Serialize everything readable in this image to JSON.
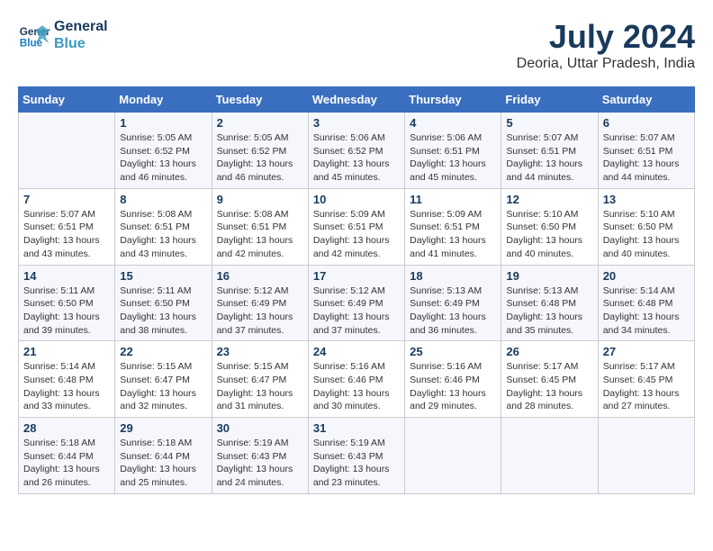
{
  "header": {
    "logo_line1": "General",
    "logo_line2": "Blue",
    "month_year": "July 2024",
    "location": "Deoria, Uttar Pradesh, India"
  },
  "days_of_week": [
    "Sunday",
    "Monday",
    "Tuesday",
    "Wednesday",
    "Thursday",
    "Friday",
    "Saturday"
  ],
  "weeks": [
    [
      {
        "day": "",
        "sunrise": "",
        "sunset": "",
        "daylight": ""
      },
      {
        "day": "1",
        "sunrise": "5:05 AM",
        "sunset": "6:52 PM",
        "daylight": "13 hours and 46 minutes."
      },
      {
        "day": "2",
        "sunrise": "5:05 AM",
        "sunset": "6:52 PM",
        "daylight": "13 hours and 46 minutes."
      },
      {
        "day": "3",
        "sunrise": "5:06 AM",
        "sunset": "6:52 PM",
        "daylight": "13 hours and 45 minutes."
      },
      {
        "day": "4",
        "sunrise": "5:06 AM",
        "sunset": "6:51 PM",
        "daylight": "13 hours and 45 minutes."
      },
      {
        "day": "5",
        "sunrise": "5:07 AM",
        "sunset": "6:51 PM",
        "daylight": "13 hours and 44 minutes."
      },
      {
        "day": "6",
        "sunrise": "5:07 AM",
        "sunset": "6:51 PM",
        "daylight": "13 hours and 44 minutes."
      }
    ],
    [
      {
        "day": "7",
        "sunrise": "5:07 AM",
        "sunset": "6:51 PM",
        "daylight": "13 hours and 43 minutes."
      },
      {
        "day": "8",
        "sunrise": "5:08 AM",
        "sunset": "6:51 PM",
        "daylight": "13 hours and 43 minutes."
      },
      {
        "day": "9",
        "sunrise": "5:08 AM",
        "sunset": "6:51 PM",
        "daylight": "13 hours and 42 minutes."
      },
      {
        "day": "10",
        "sunrise": "5:09 AM",
        "sunset": "6:51 PM",
        "daylight": "13 hours and 42 minutes."
      },
      {
        "day": "11",
        "sunrise": "5:09 AM",
        "sunset": "6:51 PM",
        "daylight": "13 hours and 41 minutes."
      },
      {
        "day": "12",
        "sunrise": "5:10 AM",
        "sunset": "6:50 PM",
        "daylight": "13 hours and 40 minutes."
      },
      {
        "day": "13",
        "sunrise": "5:10 AM",
        "sunset": "6:50 PM",
        "daylight": "13 hours and 40 minutes."
      }
    ],
    [
      {
        "day": "14",
        "sunrise": "5:11 AM",
        "sunset": "6:50 PM",
        "daylight": "13 hours and 39 minutes."
      },
      {
        "day": "15",
        "sunrise": "5:11 AM",
        "sunset": "6:50 PM",
        "daylight": "13 hours and 38 minutes."
      },
      {
        "day": "16",
        "sunrise": "5:12 AM",
        "sunset": "6:49 PM",
        "daylight": "13 hours and 37 minutes."
      },
      {
        "day": "17",
        "sunrise": "5:12 AM",
        "sunset": "6:49 PM",
        "daylight": "13 hours and 37 minutes."
      },
      {
        "day": "18",
        "sunrise": "5:13 AM",
        "sunset": "6:49 PM",
        "daylight": "13 hours and 36 minutes."
      },
      {
        "day": "19",
        "sunrise": "5:13 AM",
        "sunset": "6:48 PM",
        "daylight": "13 hours and 35 minutes."
      },
      {
        "day": "20",
        "sunrise": "5:14 AM",
        "sunset": "6:48 PM",
        "daylight": "13 hours and 34 minutes."
      }
    ],
    [
      {
        "day": "21",
        "sunrise": "5:14 AM",
        "sunset": "6:48 PM",
        "daylight": "13 hours and 33 minutes."
      },
      {
        "day": "22",
        "sunrise": "5:15 AM",
        "sunset": "6:47 PM",
        "daylight": "13 hours and 32 minutes."
      },
      {
        "day": "23",
        "sunrise": "5:15 AM",
        "sunset": "6:47 PM",
        "daylight": "13 hours and 31 minutes."
      },
      {
        "day": "24",
        "sunrise": "5:16 AM",
        "sunset": "6:46 PM",
        "daylight": "13 hours and 30 minutes."
      },
      {
        "day": "25",
        "sunrise": "5:16 AM",
        "sunset": "6:46 PM",
        "daylight": "13 hours and 29 minutes."
      },
      {
        "day": "26",
        "sunrise": "5:17 AM",
        "sunset": "6:45 PM",
        "daylight": "13 hours and 28 minutes."
      },
      {
        "day": "27",
        "sunrise": "5:17 AM",
        "sunset": "6:45 PM",
        "daylight": "13 hours and 27 minutes."
      }
    ],
    [
      {
        "day": "28",
        "sunrise": "5:18 AM",
        "sunset": "6:44 PM",
        "daylight": "13 hours and 26 minutes."
      },
      {
        "day": "29",
        "sunrise": "5:18 AM",
        "sunset": "6:44 PM",
        "daylight": "13 hours and 25 minutes."
      },
      {
        "day": "30",
        "sunrise": "5:19 AM",
        "sunset": "6:43 PM",
        "daylight": "13 hours and 24 minutes."
      },
      {
        "day": "31",
        "sunrise": "5:19 AM",
        "sunset": "6:43 PM",
        "daylight": "13 hours and 23 minutes."
      },
      {
        "day": "",
        "sunrise": "",
        "sunset": "",
        "daylight": ""
      },
      {
        "day": "",
        "sunrise": "",
        "sunset": "",
        "daylight": ""
      },
      {
        "day": "",
        "sunrise": "",
        "sunset": "",
        "daylight": ""
      }
    ]
  ]
}
